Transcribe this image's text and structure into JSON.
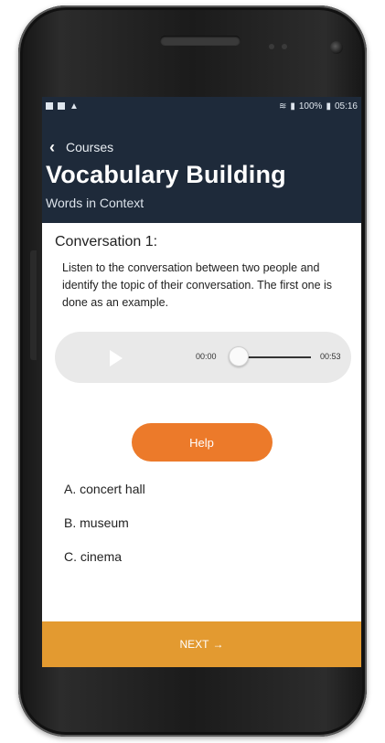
{
  "status_bar": {
    "left_icons": [
      "notification-icon",
      "message-icon",
      "alert-icon"
    ],
    "battery": "100%",
    "time": "05:16"
  },
  "header": {
    "back_label": "Courses",
    "title": "Vocabulary Building",
    "subtitle": "Words in Context"
  },
  "conversation": {
    "title": "Conversation 1:",
    "instructions": "Listen to the conversation between two people and identify the topic of their conversation. The first one is done as an example."
  },
  "player": {
    "current_time": "00:00",
    "total_time": "00:53",
    "progress": 0
  },
  "help_label": "Help",
  "options": [
    {
      "label": "A. concert hall"
    },
    {
      "label": "B. museum"
    },
    {
      "label": "C. cinema"
    }
  ],
  "next_label": "NEXT",
  "colors": {
    "header_bg": "#1e2a3a",
    "help_button": "#ec7a2a",
    "next_bar": "#e39a30",
    "player_bg": "#e9e9e9"
  }
}
